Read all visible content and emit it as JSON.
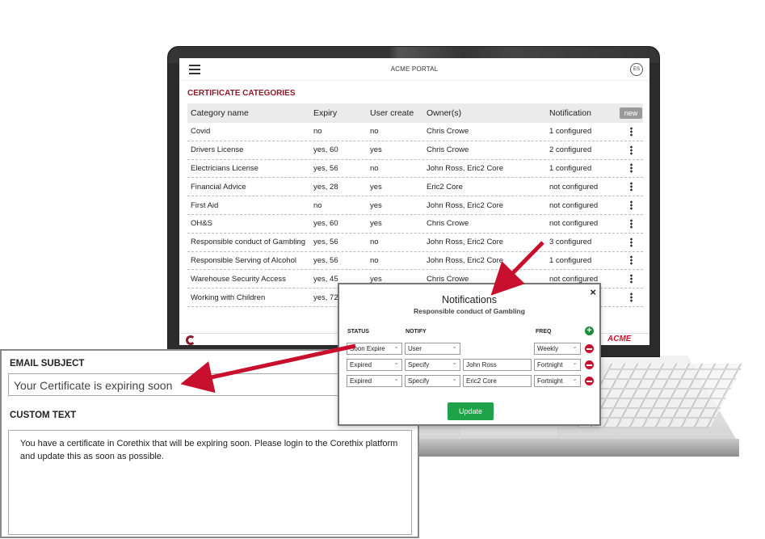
{
  "portal": {
    "title": "ACME PORTAL",
    "avatar": "ES",
    "brand_color": "#8b1a2b",
    "footer_logo": "ACME"
  },
  "categories": {
    "title": "CERTIFICATE CATEGORIES",
    "headers": [
      "Category name",
      "Expiry",
      "User create",
      "Owner(s)",
      "Notification"
    ],
    "new_label": "new",
    "rows": [
      {
        "name": "Covid",
        "expiry": "no",
        "user_create": "no",
        "owners": "Chris Crowe",
        "notification": "1 configured"
      },
      {
        "name": "Drivers License",
        "expiry": "yes, 60",
        "user_create": "yes",
        "owners": "Chris Crowe",
        "notification": "2 configured"
      },
      {
        "name": "Electricians License",
        "expiry": "yes, 56",
        "user_create": "no",
        "owners": "John Ross, Eric2 Core",
        "notification": "1 configured"
      },
      {
        "name": "Financial Advice",
        "expiry": "yes, 28",
        "user_create": "yes",
        "owners": "Eric2 Core",
        "notification": "not configured"
      },
      {
        "name": "First Aid",
        "expiry": "no",
        "user_create": "yes",
        "owners": "John Ross, Eric2 Core",
        "notification": "not configured"
      },
      {
        "name": "OH&S",
        "expiry": "yes, 60",
        "user_create": "yes",
        "owners": "Chris Crowe",
        "notification": "not configured"
      },
      {
        "name": "Responsible conduct of Gambling",
        "expiry": "yes, 56",
        "user_create": "no",
        "owners": "John Ross, Eric2 Core",
        "notification": "3 configured"
      },
      {
        "name": "Responsible Serving of Alcohol",
        "expiry": "yes, 56",
        "user_create": "no",
        "owners": "John Ross, Eric2 Core",
        "notification": "1 configured"
      },
      {
        "name": "Warehouse Security Access",
        "expiry": "yes, 45",
        "user_create": "yes",
        "owners": "Chris Crowe",
        "notification": "not configured"
      },
      {
        "name": "Working with Children",
        "expiry": "yes, 72",
        "user_create": "",
        "owners": "",
        "notification": ""
      }
    ]
  },
  "notifications": {
    "title": "Notifications",
    "subtitle": "Responsible conduct of Gambling",
    "headers": {
      "status": "STATUS",
      "notify": "NOTIFY",
      "freq": "FREQ"
    },
    "close": "×",
    "rows": [
      {
        "status": "Soon Expire",
        "notify": "User",
        "person": "",
        "freq": "Weekly"
      },
      {
        "status": "Expired",
        "notify": "Specify",
        "person": "John Ross",
        "freq": "Fortnight"
      },
      {
        "status": "Expired",
        "notify": "Specify",
        "person": "Eric2 Core",
        "freq": "Fortnight"
      }
    ],
    "update_label": "Update"
  },
  "email": {
    "subject_label": "EMAIL SUBJECT",
    "subject_value": "Your Certificate is expiring soon",
    "custom_label": "CUSTOM TEXT",
    "custom_value": "You have a certificate in Corethix that will be expiring soon. Please login to the Corethix platform and update this as soon as possible."
  },
  "colors": {
    "arrow": "#c8102e",
    "add": "#1f8b3a",
    "remove": "#c8102e",
    "update": "#1ea24a"
  }
}
